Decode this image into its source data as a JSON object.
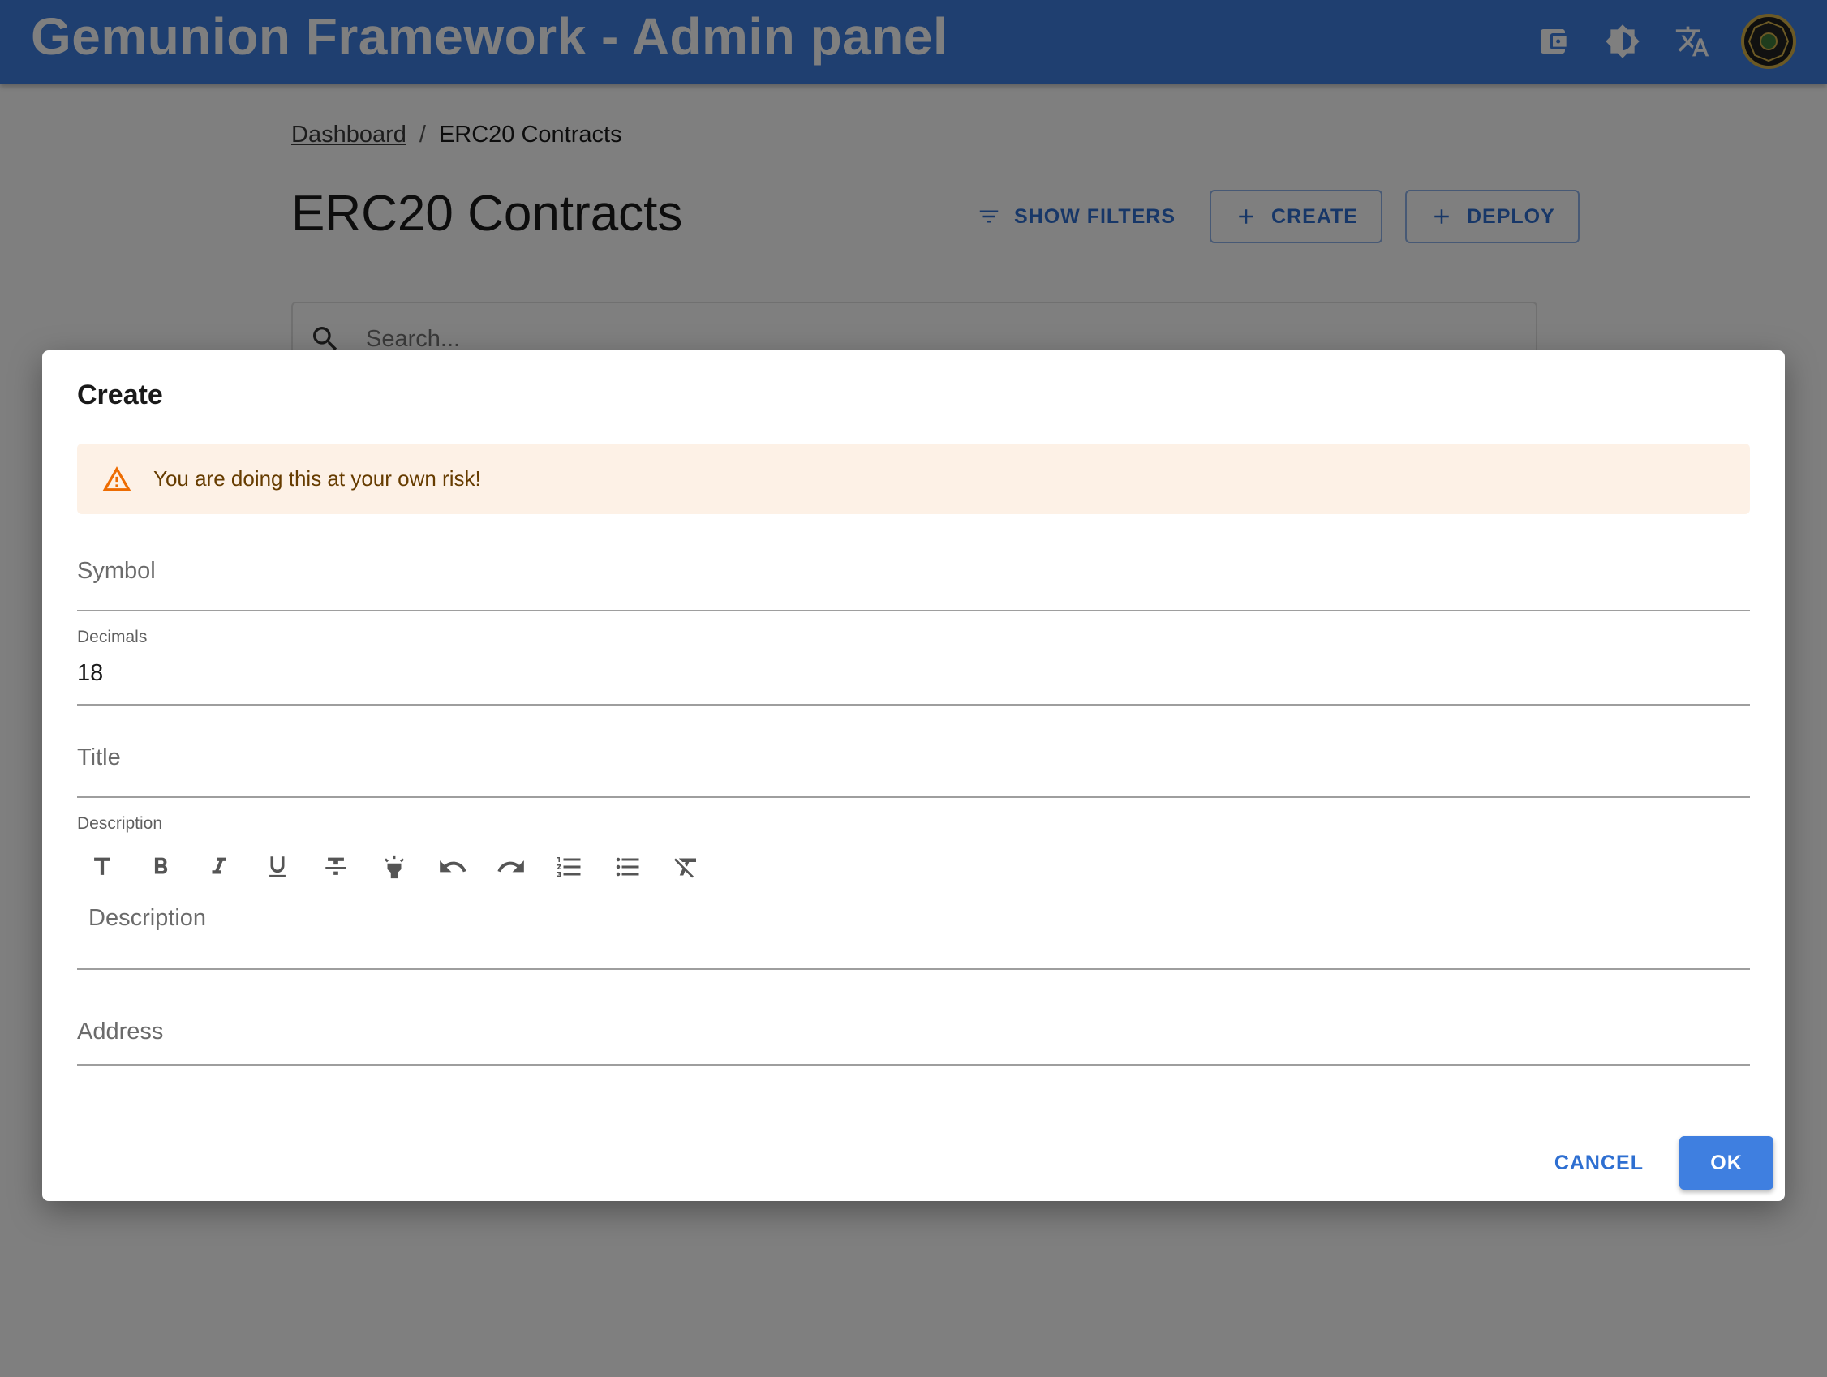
{
  "app": {
    "title": "Gemunion Framework - Admin panel",
    "icons": [
      "wallet-icon",
      "brightness-icon",
      "translate-icon",
      "avatar"
    ]
  },
  "breadcrumb": {
    "items": [
      {
        "label": "Dashboard"
      },
      {
        "label": "ERC20 Contracts"
      }
    ],
    "separator": "/"
  },
  "page": {
    "title": "ERC20 Contracts",
    "actions": {
      "show_filters": "SHOW FILTERS",
      "create": "CREATE",
      "deploy": "DEPLOY"
    },
    "search": {
      "placeholder": "Search..."
    }
  },
  "dialog": {
    "title": "Create",
    "alert": {
      "text": "You are doing this at your own risk!",
      "color": "#ed6c02"
    },
    "fields": {
      "symbol": {
        "label": "Symbol",
        "value": ""
      },
      "decimals": {
        "label": "Decimals",
        "value": "18"
      },
      "title": {
        "label": "Title",
        "value": ""
      },
      "description": {
        "label": "Description",
        "placeholder": "Description"
      },
      "address": {
        "label": "Address",
        "value": ""
      }
    },
    "toolbar": [
      "title-icon",
      "bold-icon",
      "italic-icon",
      "underline-icon",
      "strikethrough-icon",
      "highlight-icon",
      "undo-icon",
      "redo-icon",
      "numbered-list-icon",
      "bulleted-list-icon",
      "clear-format-icon"
    ],
    "actions": {
      "cancel": "CANCEL",
      "ok": "OK"
    }
  },
  "colors": {
    "primary": "#3f7fe0",
    "primary_text": "#2e6fd1",
    "warning_bg": "#fdf1e6",
    "warning_text": "#663c00"
  }
}
